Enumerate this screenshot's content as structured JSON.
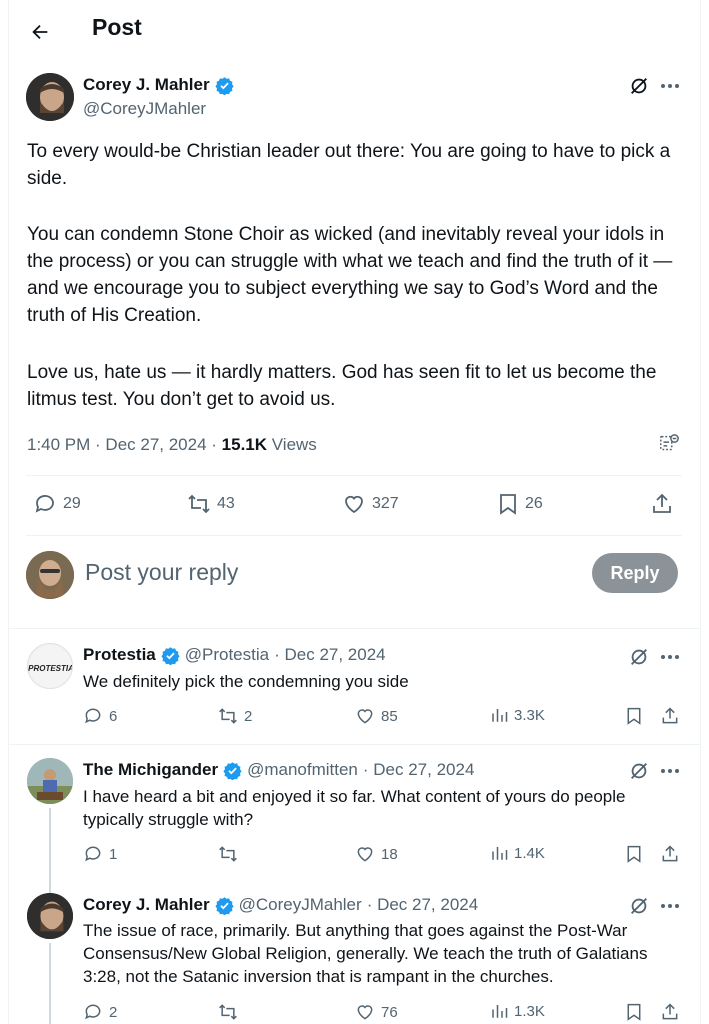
{
  "header": {
    "title": "Post"
  },
  "main_post": {
    "author_name": "Corey J. Mahler",
    "handle": "@CoreyJMahler",
    "paragraphs": [
      "To every would-be Christian leader out there: You are going to have to pick a side.",
      "You can condemn Stone Choir as wicked (and inevitably reveal your idols in the process) or you can struggle with what we teach and find the truth of it — and we encourage you to subject everything we say to God’s Word and the truth of His Creation.",
      "Love us, hate us — it hardly matters. God has seen fit to let us become the litmus test. You don’t get to avoid us."
    ],
    "timestamp": "1:40 PM · Dec 27, 2024 · ",
    "views_count": "15.1K",
    "views_label": " Views",
    "replies": "29",
    "reposts": "43",
    "likes": "327",
    "bookmarks": "26"
  },
  "composer": {
    "placeholder": "Post your reply",
    "reply_button": "Reply"
  },
  "replies": [
    {
      "name": "Protestia",
      "handle": "@Protestia",
      "date": " · Dec 27, 2024",
      "avatar_text": "PROTESTIA",
      "text": "We definitely pick the condemning you side",
      "replies": "6",
      "reposts": "2",
      "likes": "85",
      "views": "3.3K"
    },
    {
      "name": "The Michigander",
      "handle": "@manofmitten",
      "date": " · Dec 27, 2024",
      "text": "I have heard a bit and enjoyed it so far. What content of yours do people typically struggle with?",
      "replies": "1",
      "reposts": "",
      "likes": "18",
      "views": "1.4K"
    },
    {
      "name": "Corey J. Mahler",
      "handle": "@CoreyJMahler",
      "date": " · Dec 27, 2024",
      "text": "The issue of race, primarily. But anything that goes against the Post-War Consensus/New Global Religion, generally. We teach the truth of Galatians 3:28, not the Satanic inversion that is rampant in the churches.",
      "replies": "2",
      "reposts": "",
      "likes": "76",
      "views": "1.3K"
    }
  ],
  "colors": {
    "verified": "#1d9bf0",
    "muted": "#536471",
    "reply_button_bg": "#8b9298"
  }
}
